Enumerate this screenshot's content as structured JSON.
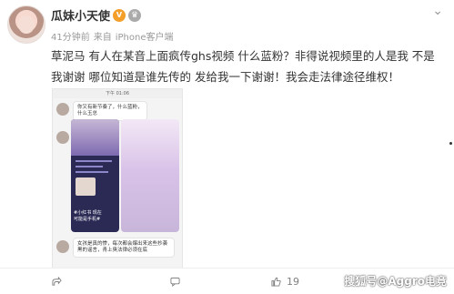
{
  "post": {
    "username": "瓜妹小天使",
    "timestamp": "41分钟前",
    "source_prefix": "来自",
    "source_device": "iPhone客户端",
    "text": "草泥马 有人在某音上面疯传ghs视频 什么蓝粉？非得说视频里的人是我 不是我谢谢 哪位知道是谁先传的 发给我一下谢谢！我会走法律途径维权！"
  },
  "screenshot": {
    "time": "下午 01:06",
    "message_1": "你又有新节奏了，什么蓝粉，什么玉总",
    "phone_caption_1": "#小红书 现在",
    "phone_caption_2": "可能是手机#",
    "message_2": "女孩是真的惨，每次都会爆出来这些抄袭黑的谣言，青上臭法律必须在底"
  },
  "footer": {
    "comments_count": "",
    "likes_count": "19"
  },
  "watermark": "搜狐号@Aggro电竞",
  "colors": {
    "vip": "#f49f2a",
    "text": "#333333",
    "meta": "#999999"
  }
}
